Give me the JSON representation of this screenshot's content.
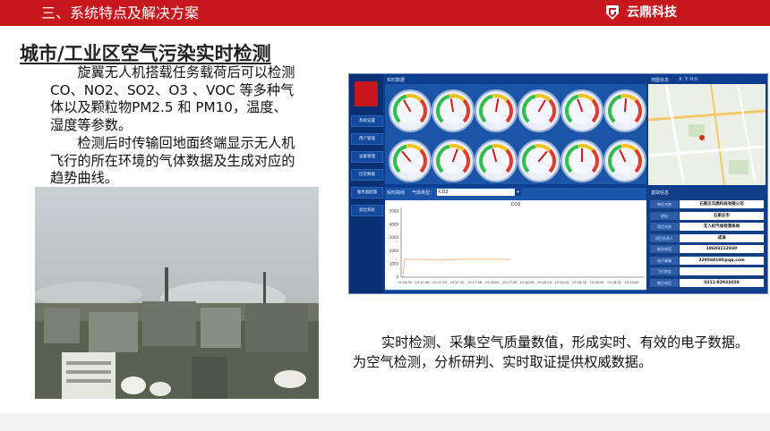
{
  "header": {
    "section_title": "三、系统特点及解决方案",
    "brand": "云鼎科技"
  },
  "slide": {
    "title": "城市/工业区空气污染实时检测",
    "paragraph1_lines": [
      "　　旋翼无人机搭载任务载荷后可以检测",
      "CO、NO2、SO2、O3 、VOC 等多种气",
      "体以及颗粒物PM2.5 和 PM10，温度、",
      "湿度等参数。"
    ],
    "paragraph2_lines": [
      "　　检测后时传输回地面终端显示无人机",
      "飞行的所在环境的气体数据及生成对应的",
      "趋势曲线。"
    ],
    "bottom_lines": [
      "实时检测、采集空气质量数值，形成实时、有效的电子数据。",
      "为空气检测，分析研判、实时取证提供权威数据。"
    ]
  },
  "dashboard": {
    "realtime_header": "实时数据",
    "map_header": "地图信息",
    "map_coords": "X: Y: H:0",
    "curve_header": "实时曲线",
    "gas_type_label": "气体类型：",
    "gas_type_value": "CO2",
    "plot_title": "CO2",
    "info_header": "基础信息",
    "nav_items": [
      "系统设置",
      "用户管理",
      "设备管理",
      "历史数据",
      "服务器配置",
      "退出系统"
    ],
    "info_rows": [
      {
        "key": "单位名称",
        "value": "石家庄云鼎科技有限公司"
      },
      {
        "key": "地址",
        "value": "石家庄市"
      },
      {
        "key": "项目名称",
        "value": "无人机气体检测系统"
      },
      {
        "key": "项目负责人",
        "value": "成涛"
      },
      {
        "key": "联系电话",
        "value": "18603112930"
      },
      {
        "key": "电子邮箱",
        "value": "329568180@qq.com"
      },
      {
        "key": "飞行地址",
        "value": ""
      },
      {
        "key": "售后电话",
        "value": "0311-82933029"
      }
    ],
    "y_ticks": [
      "5000",
      "4000",
      "3000",
      "2000",
      "1000",
      "0"
    ],
    "x_ticks": [
      "19:16:50",
      "19:17:06",
      "19:17:24",
      "19:17:32",
      "19:17:48",
      "19:18:00",
      "19:17:56",
      "19:18:08",
      "19:18:24",
      "19:18:20",
      "19:18:32",
      "19:18:44",
      "19:18:52",
      "19:19:00"
    ]
  }
}
